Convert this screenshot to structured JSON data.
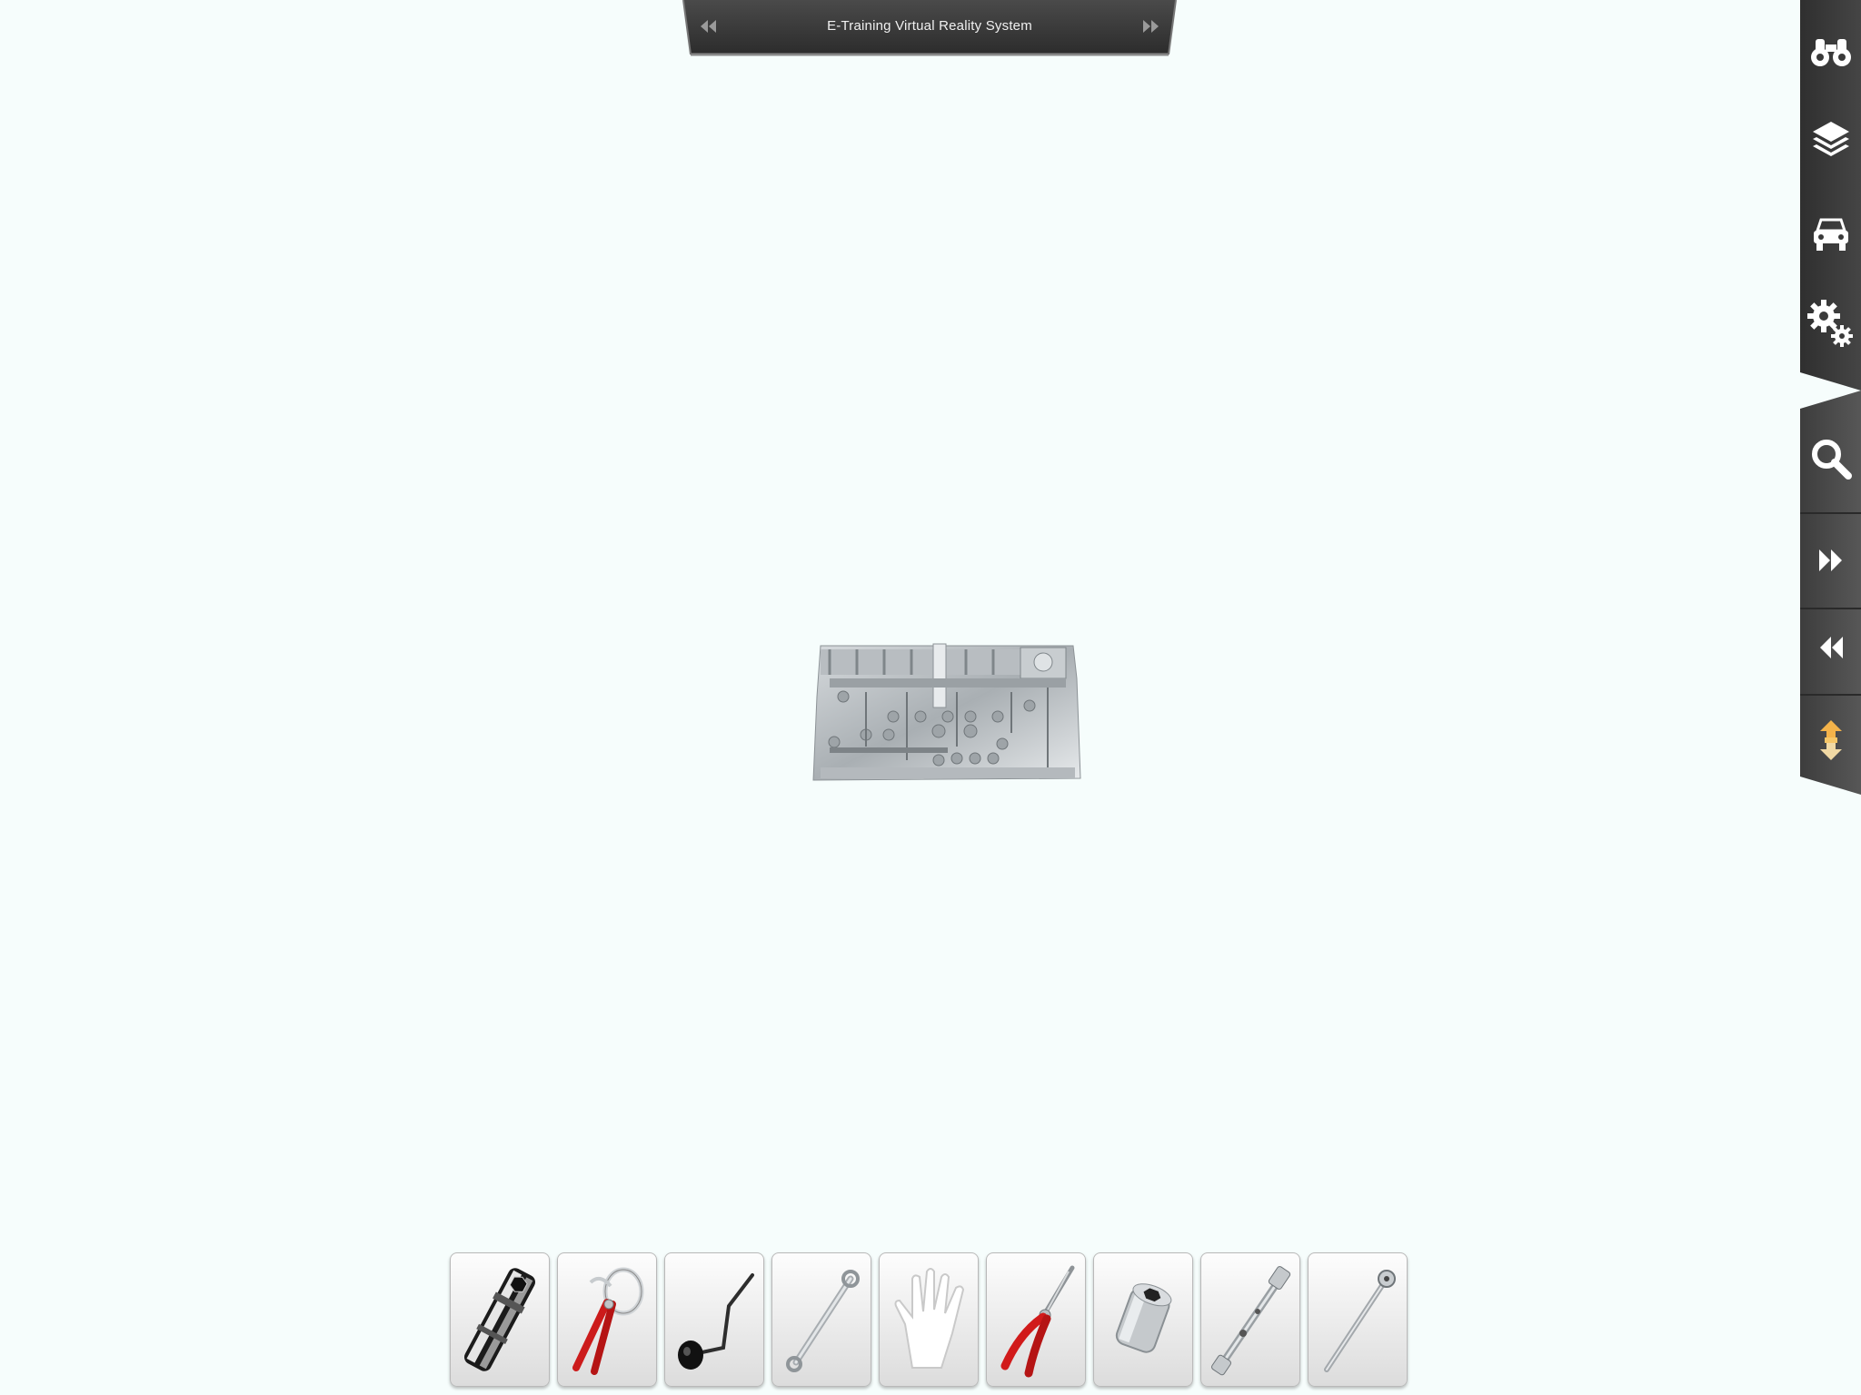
{
  "header": {
    "title": "E-Training Virtual Reality System",
    "prev_icon": "rewind-icon",
    "next_icon": "fast-forward-icon"
  },
  "sidebar": {
    "top_buttons": [
      {
        "icon": "binoculars-icon",
        "action": "view"
      },
      {
        "icon": "layers-icon",
        "action": "layers"
      },
      {
        "icon": "car-icon",
        "action": "vehicle"
      },
      {
        "icon": "gears-icon",
        "action": "settings"
      }
    ],
    "bottom_buttons": [
      {
        "icon": "magnifier-icon",
        "action": "search"
      },
      {
        "icon": "fast-forward-icon",
        "action": "next-step"
      },
      {
        "icon": "rewind-icon",
        "action": "previous-step"
      },
      {
        "icon": "up-down-arrow-icon",
        "action": "toggle"
      }
    ]
  },
  "model": {
    "icon": "engine-cylinder-head-model"
  },
  "tools": [
    {
      "icon": "deep-socket-icon"
    },
    {
      "icon": "oil-filter-pliers-icon"
    },
    {
      "icon": "crank-handle-icon"
    },
    {
      "icon": "box-wrench-icon"
    },
    {
      "icon": "hand-glove-icon"
    },
    {
      "icon": "needle-nose-pliers-icon"
    },
    {
      "icon": "hex-socket-icon"
    },
    {
      "icon": "extension-bar-icon"
    },
    {
      "icon": "ratchet-handle-icon"
    }
  ],
  "colors": {
    "background": "#f6fdfc",
    "panel_dark": "#3a3a3a",
    "accent_red": "#d11a1a"
  }
}
